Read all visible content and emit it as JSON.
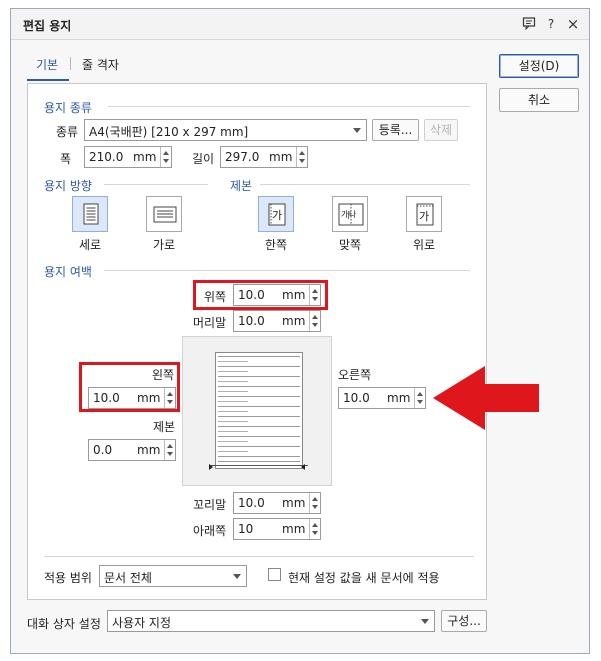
{
  "dialog": {
    "title": "편집 용지",
    "help_icon": "?",
    "close_icon": "×"
  },
  "tabs": [
    {
      "label": "기본",
      "active": true
    },
    {
      "label": "줄 격자",
      "active": false
    }
  ],
  "buttons": {
    "ok": "설정(D)",
    "cancel": "취소",
    "register": "등록...",
    "delete": "삭제",
    "configure": "구성..."
  },
  "paper_type": {
    "section": "용지 종류",
    "kind_label": "종류",
    "kind_value": "A4(국배판) [210 x 297 mm]",
    "width_label": "폭",
    "width_value": "210.0",
    "width_unit": "mm",
    "length_label": "길이",
    "length_value": "297.0",
    "length_unit": "mm"
  },
  "orientation": {
    "section": "용지 방향",
    "portrait": "세로",
    "landscape": "가로",
    "selected": "세로"
  },
  "binding": {
    "section": "제본",
    "single": "한쪽",
    "facing": "맞쪽",
    "top": "위로",
    "selected": "한쪽",
    "glyph_single": "가",
    "glyph_facing": "가|나",
    "glyph_top": "가"
  },
  "margins": {
    "section": "용지 여백",
    "top_label": "위쪽",
    "top_value": "10.0",
    "header_label": "머리말",
    "header_value": "10.0",
    "left_label": "왼쪽",
    "left_value": "10.0",
    "gutter_label": "제본",
    "gutter_value": "0.0",
    "right_label": "오른쪽",
    "right_value": "10.0",
    "footer_label": "꼬리말",
    "footer_value": "10.0",
    "bottom_label": "아래쪽",
    "bottom_value": "10",
    "unit": "mm"
  },
  "apply": {
    "scope_label": "적용 범위",
    "scope_value": "문서 전체",
    "new_doc_label": "현재 설정 값을 새 문서에 적용",
    "new_doc_checked": false
  },
  "dialog_settings": {
    "label": "대화 상자 설정",
    "value": "사용자 지정"
  },
  "colors": {
    "accent": "#2f5aa8",
    "highlight_red": "#e0161d"
  }
}
